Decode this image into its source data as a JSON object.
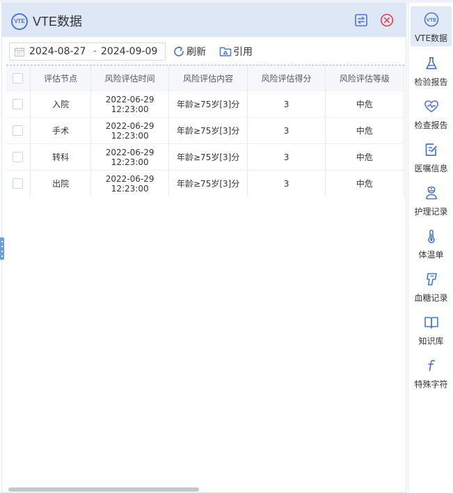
{
  "panel": {
    "badge": "VTE",
    "title": "VTE数据"
  },
  "toolbar": {
    "date_start": "2024-08-27",
    "date_separator": "-",
    "date_end": "2024-09-09",
    "refresh_label": "刷新",
    "cite_label": "引用"
  },
  "table": {
    "headers": [
      "评估节点",
      "风险评估时间",
      "风险评估内容",
      "风险评估得分",
      "风险评估等级"
    ],
    "rows": [
      {
        "node": "入院",
        "date": "2022-06-29",
        "time": "12:23:00",
        "content": "年龄≥75岁[3]分",
        "score": "3",
        "level": "中危"
      },
      {
        "node": "手术",
        "date": "2022-06-29",
        "time": "12:23:00",
        "content": "年龄≥75岁[3]分",
        "score": "3",
        "level": "中危"
      },
      {
        "node": "转科",
        "date": "2022-06-29",
        "time": "12:23:00",
        "content": "年龄≥75岁[3]分",
        "score": "3",
        "level": "中危"
      },
      {
        "node": "出院",
        "date": "2022-06-29",
        "time": "12:23:00",
        "content": "年龄≥75岁[3]分",
        "score": "3",
        "level": "中危"
      }
    ]
  },
  "sidebar": {
    "items": [
      {
        "label": "VTE数据",
        "icon": "vte-icon",
        "active": true
      },
      {
        "label": "检验报告",
        "icon": "flask-icon"
      },
      {
        "label": "检查报告",
        "icon": "heart-pulse-icon"
      },
      {
        "label": "医嘱信息",
        "icon": "edit-document-icon"
      },
      {
        "label": "护理记录",
        "icon": "nurse-icon"
      },
      {
        "label": "体温单",
        "icon": "thermometer-icon"
      },
      {
        "label": "血糖记录",
        "icon": "glucose-meter-icon"
      },
      {
        "label": "知识库",
        "icon": "book-icon"
      },
      {
        "label": "特殊字符",
        "icon": "function-symbol-icon"
      }
    ]
  },
  "colors": {
    "accent": "#4a76c8",
    "header_bg": "#dde7f6",
    "close": "#e8454f"
  }
}
